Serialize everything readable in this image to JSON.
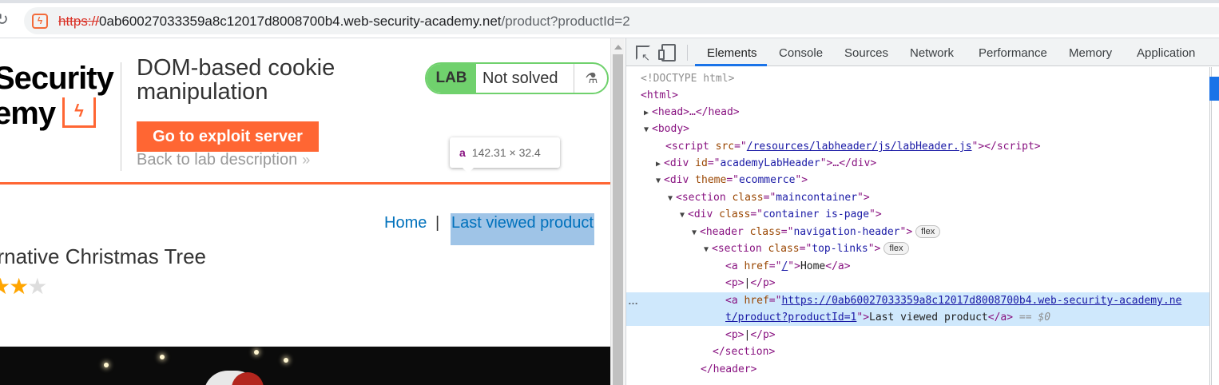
{
  "browser": {
    "url_scheme": "https://",
    "url_host": "0ab60027033359a8c12017d8008700b4.web-security-academy.net",
    "url_path": "/product?productId=2"
  },
  "lab_header": {
    "logo_line1": "Security",
    "logo_line2": "emy",
    "logo_mark": "ϟ",
    "title": "DOM-based cookie manipulation",
    "exploit_button": "Go to exploit server",
    "back_link": "Back to lab description",
    "back_chevron": "»",
    "status_tag": "LAB",
    "status_text": "Not solved",
    "flask_icon": "⚗"
  },
  "tooltip": {
    "tag": "a",
    "dims": "142.31 × 32.4"
  },
  "nav": {
    "home": "Home",
    "separator": "|",
    "last_viewed": "Last viewed product"
  },
  "product": {
    "title": "ernative Christmas Tree",
    "rating_filled": 2,
    "rating_total": 3
  },
  "devtools": {
    "tabs": [
      "Elements",
      "Console",
      "Sources",
      "Network",
      "Performance",
      "Memory",
      "Application"
    ],
    "active_tab": "Elements",
    "dom": {
      "doctype": "<!DOCTYPE html>",
      "html_open": "<html>",
      "head": "<head>…</head>",
      "body_open": "<body>",
      "script_src": "/resources/labheader/js/labHeader.js",
      "div_id": "academyLabHeader",
      "div_theme": "ecommerce",
      "section_class": "maincontainer",
      "container_class": "container is-page",
      "header_class": "navigation-header",
      "toplinks_class": "top-links",
      "flex_badge": "flex",
      "home_href": "/",
      "home_text": "Home",
      "p_text": "|",
      "selected_href_1": "https://0ab60027033359a8c12017d8008700b4.web-security-academy.ne",
      "selected_href_2": "t/product?productId=1",
      "selected_text": "Last viewed product",
      "dollar0": "== $0",
      "ellipsis": "…",
      "section_close": "</section>",
      "header_close": "</header>"
    }
  },
  "colors": {
    "accent_orange": "#ff6633",
    "lab_green": "#70d16d",
    "link_blue": "#0071bc",
    "devtools_active": "#1a73e8"
  }
}
